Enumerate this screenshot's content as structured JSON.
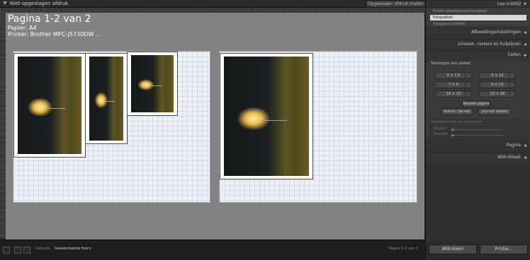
{
  "window": {
    "title": "Niet-opgeslagen afdruk",
    "saved_print_button": "Opgeslagen afdruk maken"
  },
  "page_info": {
    "title": "Pagina 1-2 van 2",
    "paper": "Papier: A4",
    "printer": "Printer: Brother MFC-J5730DW ..."
  },
  "bottombar": {
    "use_label": "Gebruik:",
    "use_value": "Geselecteerde foto's",
    "page_count": "Pagina 1-2 van 2"
  },
  "panel": {
    "layout_style": {
      "title": "Lay-outstijl",
      "options": [
        {
          "label": "Enkele afbeelding/contactblad",
          "selected": false
        },
        {
          "label": "Fotopakket",
          "selected": true
        },
        {
          "label": "Aangepast pakket",
          "selected": false
        }
      ]
    },
    "image_settings": {
      "title": "Afbeeldingsinstellingen"
    },
    "rulers": {
      "title": "Linialen, rasters en hulplijnen"
    },
    "cells": {
      "title": "Cellen",
      "add_to_package": "Toevoegen aan pakket",
      "buttons": [
        "5 × 7,5",
        "6 × 13",
        "7 × 9",
        "8 × 12",
        "10 × 13",
        "13 × 18"
      ],
      "new_page": "Nieuwe pagina",
      "auto_layout": "Autom. lay-out",
      "clear_layout": "Lay-out wissen",
      "adjust_label": "Geselecteerde cel aanpassen",
      "height_label": "Hoogte",
      "width_label": "Breedte",
      "height_value": "",
      "width_value": ""
    },
    "page": {
      "title": "Pagina"
    },
    "print_job": {
      "title": "Afdruktaak"
    },
    "print_button": "Afdrukken",
    "printer_button": "Printer..."
  }
}
